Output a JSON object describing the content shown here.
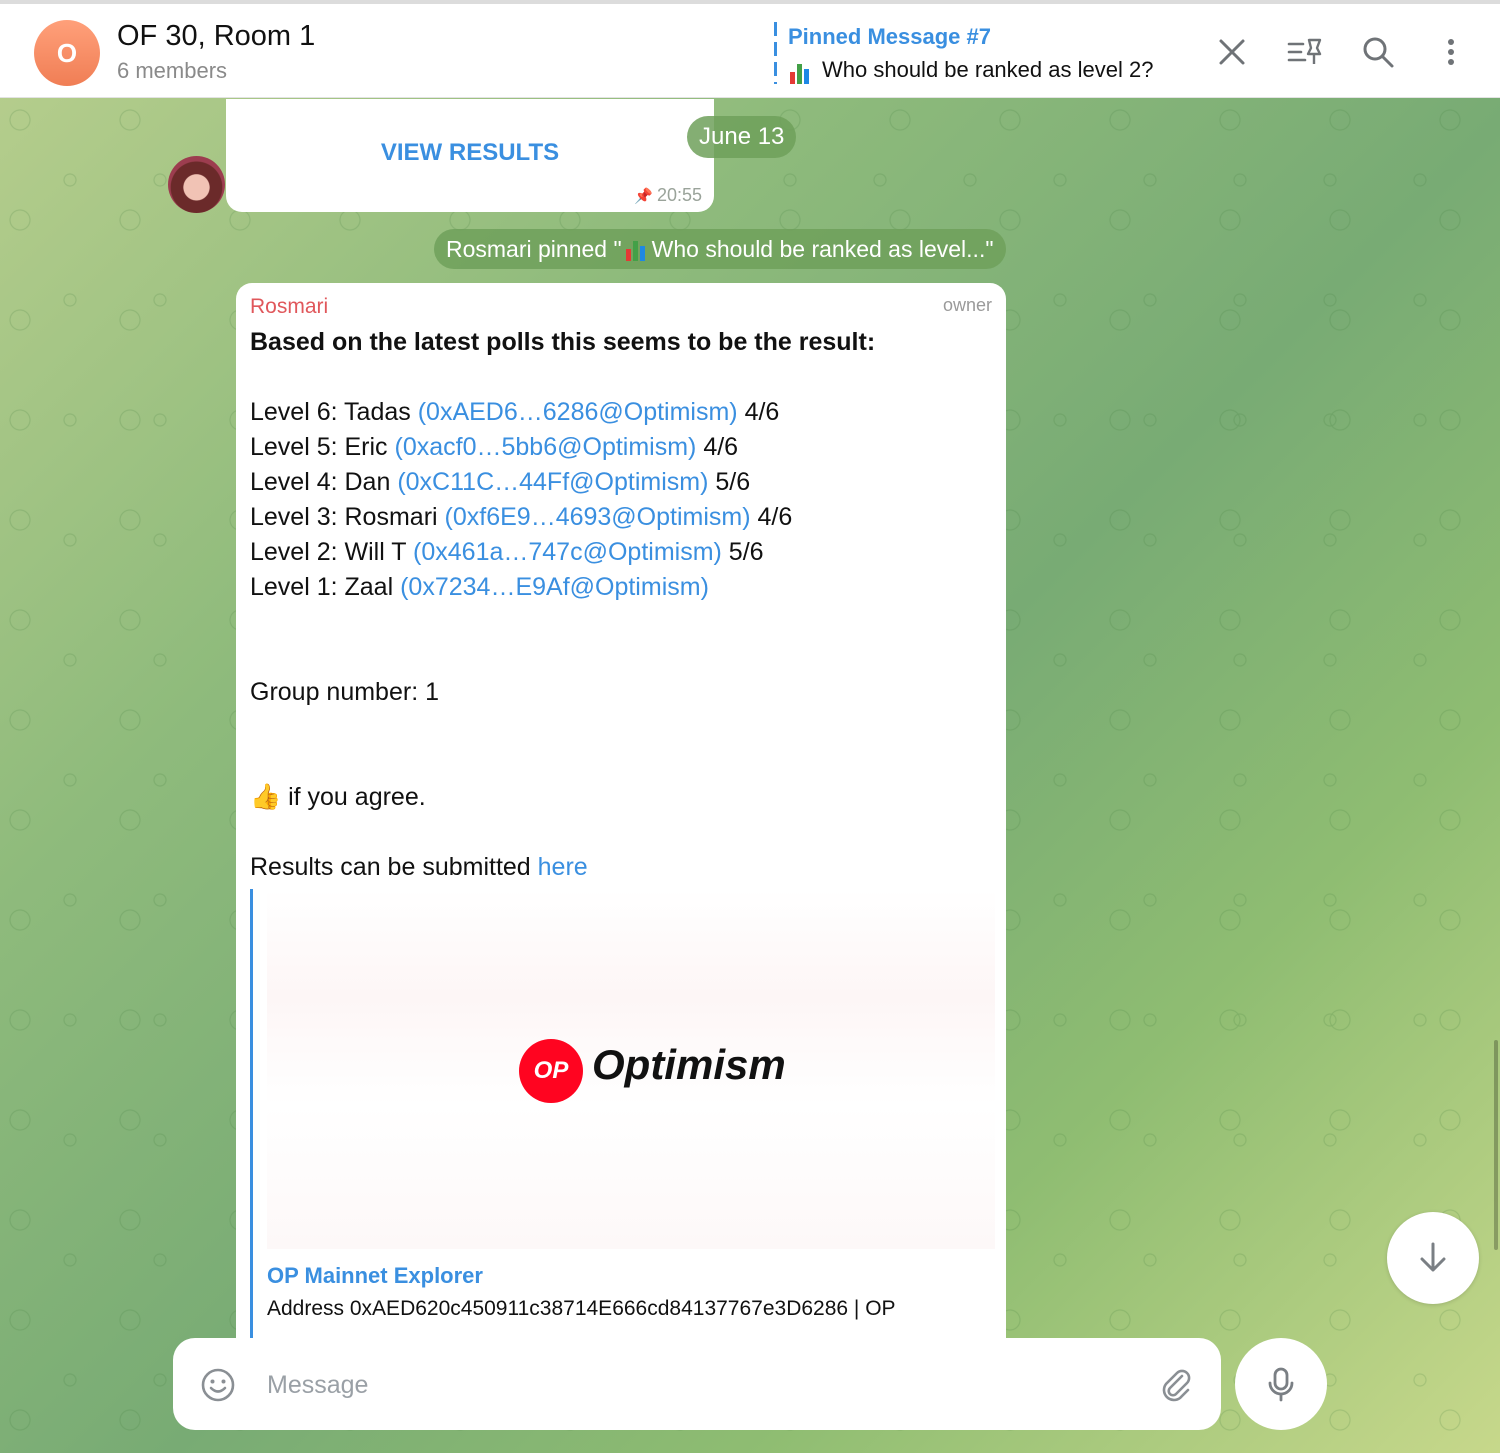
{
  "header": {
    "avatar_letter": "O",
    "title": "OF 30, Room 1",
    "subtitle": "6 members",
    "pinned_label": "Pinned Message #7",
    "pinned_text": "Who should be ranked as level 2?",
    "icons": [
      "close-icon",
      "pinned-list-icon",
      "search-icon",
      "more-vertical-icon"
    ]
  },
  "poll_message": {
    "view_results": "VIEW RESULTS",
    "time": "20:55"
  },
  "date_pill": "June 13",
  "service_message": {
    "prefix": "Rosmari pinned \"",
    "text": "Who should be ranked as level...\""
  },
  "message": {
    "sender": "Rosmari",
    "role": "owner",
    "intro": "Based on the latest polls this seems to be the result:",
    "levels": [
      {
        "label": "Level 6: Tadas ",
        "link": "(0xAED6…6286@Optimism)",
        "score": " 4/6"
      },
      {
        "label": "Level 5: Eric ",
        "link": "(0xacf0…5bb6@Optimism)",
        "score": " 4/6"
      },
      {
        "label": "Level 4: Dan ",
        "link": "(0xC11C…44Ff@Optimism)",
        "score": " 5/6"
      },
      {
        "label": "Level 3: Rosmari ",
        "link": "(0xf6E9…4693@Optimism)",
        "score": " 4/6"
      },
      {
        "label": "Level 2: Will T ",
        "link": "(0x461a…747c@Optimism)",
        "score": " 5/6"
      },
      {
        "label": "Level 1: Zaal ",
        "link": "(0x7234…E9Af@Optimism)",
        "score": ""
      }
    ],
    "group": "Group number: 1",
    "agree": " if you agree.",
    "submit_text": "Results can be submitted ",
    "submit_link": "here",
    "preview": {
      "logo_text": "OP",
      "brand": "Optimism",
      "site": "OP Mainnet Explorer",
      "title": "Address 0xAED620c450911c38714E666cd84137767e3D6286 | OP"
    }
  },
  "composer": {
    "placeholder": "Message"
  }
}
